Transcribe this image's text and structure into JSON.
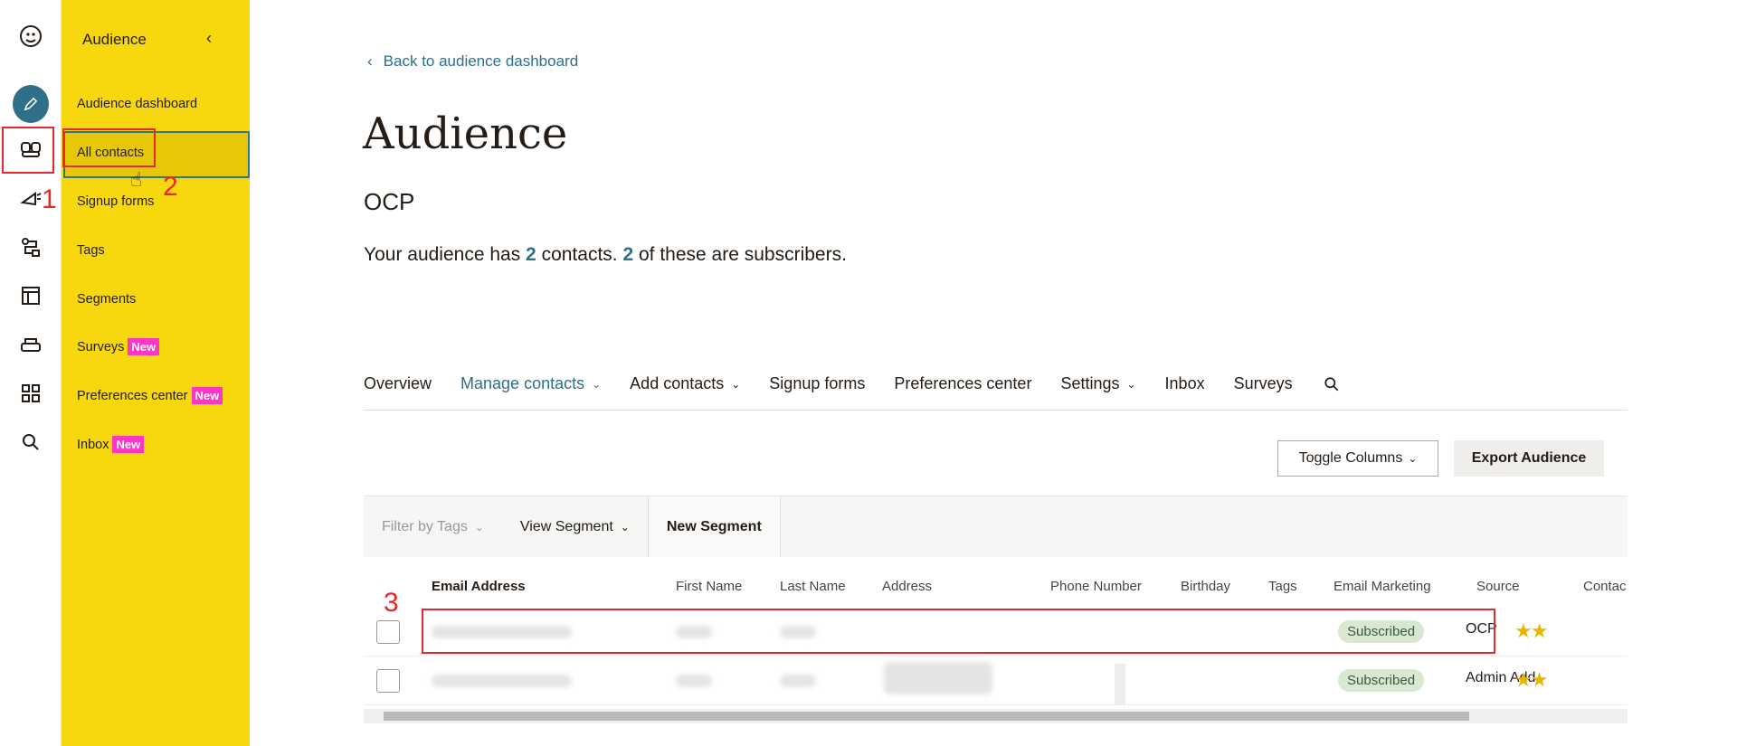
{
  "nav": {
    "title": "Audience",
    "items": [
      {
        "label": "Audience dashboard",
        "badge": ""
      },
      {
        "label": "All contacts",
        "badge": ""
      },
      {
        "label": "Signup forms",
        "badge": ""
      },
      {
        "label": "Tags",
        "badge": ""
      },
      {
        "label": "Segments",
        "badge": ""
      },
      {
        "label": "Surveys",
        "badge": "New"
      },
      {
        "label": "Preferences center",
        "badge": "New"
      },
      {
        "label": "Inbox",
        "badge": "New"
      }
    ]
  },
  "annotations": {
    "one": "1",
    "two": "2",
    "three": "3"
  },
  "main": {
    "back_link": "Back to audience dashboard",
    "title": "Audience",
    "audience_name": "OCP",
    "summary_prefix": "Your audience has ",
    "contacts_count": "2",
    "summary_mid": " contacts. ",
    "subscribers_count": "2",
    "summary_suffix": " of these are subscribers."
  },
  "tabs": [
    {
      "label": "Overview"
    },
    {
      "label": "Manage contacts"
    },
    {
      "label": "Add contacts"
    },
    {
      "label": "Signup forms"
    },
    {
      "label": "Preferences center"
    },
    {
      "label": "Settings"
    },
    {
      "label": "Inbox"
    },
    {
      "label": "Surveys"
    }
  ],
  "buttons": {
    "toggle_columns": "Toggle Columns",
    "export_audience": "Export Audience"
  },
  "filterbar": {
    "filter_tags": "Filter by Tags",
    "view_segment": "View Segment",
    "new_segment": "New Segment"
  },
  "table": {
    "headers": [
      "Email Address",
      "First Name",
      "Last Name",
      "Address",
      "Phone Number",
      "Birthday",
      "Tags",
      "Email Marketing",
      "Source",
      "Contac"
    ],
    "rows": [
      {
        "email_marketing": "Subscribed",
        "source": "OCP",
        "rating": "★★"
      },
      {
        "email_marketing": "Subscribed",
        "source": "Admin Add",
        "rating": "★★"
      }
    ]
  },
  "colors": {
    "nav_bg": "#f7d80e",
    "accent": "#2f6f87",
    "badge": "#ff35c4",
    "annotation": "#e8272b"
  }
}
